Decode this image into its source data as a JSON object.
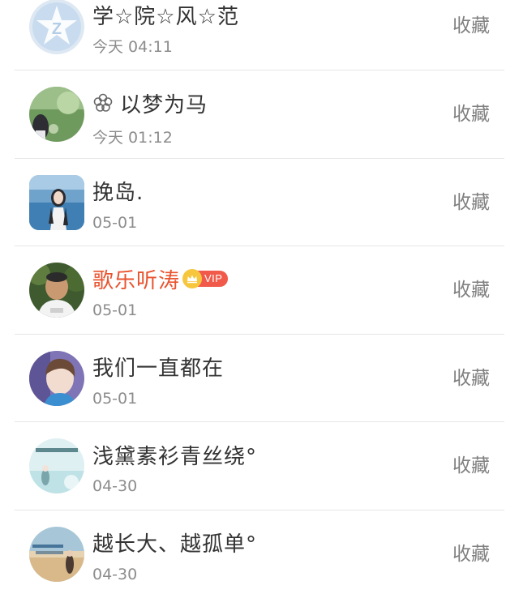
{
  "items": [
    {
      "name": "学☆院☆风☆范",
      "time": "今天 04:11",
      "action": "收藏",
      "avatar": "qzone-logo"
    },
    {
      "name": "以梦为马",
      "time": "今天 01:12",
      "action": "收藏",
      "prefix_icon": "flower-icon",
      "avatar": "girl-garden"
    },
    {
      "name": "挽岛.",
      "time": "05-01",
      "action": "收藏",
      "avatar": "girl-seaside"
    },
    {
      "name": "歌乐听涛",
      "time": "05-01",
      "action": "收藏",
      "vip_label": "VIP",
      "accent": "#e8532f",
      "avatar": "man-portrait"
    },
    {
      "name": "我们一直都在",
      "time": "05-01",
      "action": "收藏",
      "avatar": "boy-portrait"
    },
    {
      "name": "浅黛素衫青丝绕°",
      "time": "04-30",
      "action": "收藏",
      "avatar": "illustration-pale"
    },
    {
      "name": "越长大、越孤单°",
      "time": "04-30",
      "action": "收藏",
      "avatar": "figure-sunset"
    }
  ]
}
